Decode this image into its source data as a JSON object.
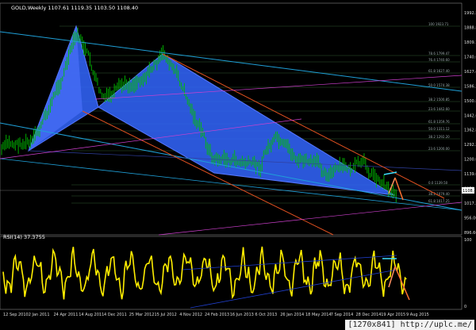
{
  "chart_data": [
    {
      "type": "candlestick",
      "symbol_header": "GOLD,Weekly  1107.61 1119.35 1103.50 1108.40",
      "y_ticks": [
        "1992.50",
        "1888.80",
        "1809.70",
        "1740.60",
        "1627.40",
        "1586.20",
        "1500.85",
        "1442.60",
        "1362.80",
        "1292.20",
        "1200.00",
        "1139.60",
        "1079.40",
        "1017.25",
        "956.00",
        "896.60"
      ],
      "price_marker": "1108.40",
      "x_ticks": [
        "12 Sep 2010",
        "2 Jan 2011",
        "24 Apr 2011",
        "14 Aug 2011",
        "4 Dec 2011",
        "25 Mar 2012",
        "15 Jul 2012",
        "4 Nov 2012",
        "24 Feb 2013",
        "16 Jun 2013",
        "6 Oct 2013",
        "26 Jan 2014",
        "18 May 2014",
        "7 Sep 2014",
        "28 Dec 2014",
        "19 Apr 2015",
        "9 Aug 2015"
      ],
      "fib_labels": [
        "100 1923.71",
        "78.6 1799.47",
        "76.4 1740.60",
        "61.8 1627.40",
        "50.0 1574.38",
        "38.2 1500.85",
        "23.6 1442.60",
        "61.8 1359.76",
        "50.0 1311.12",
        "38.2 1292.20",
        "23.6 1200.00",
        "0.0 1139.50",
        "38.2 1079.40",
        "61.8 1017.25"
      ],
      "patterns": [
        {
          "name": "first-harmonic-triangle",
          "color": "#3366ff"
        },
        {
          "name": "second-harmonic-triangle",
          "color": "#3366ff"
        }
      ],
      "colors": {
        "bullish": "#00c000",
        "bearish": "#00c000",
        "channel": "#1fa0d8",
        "resistance": "#e05020",
        "support": "#e05020",
        "magenta": "#d040d0",
        "arrow_up": "#ff9060",
        "arrow_down": "#ff7030",
        "arrow_cyan": "#40e0ff"
      }
    },
    {
      "type": "line",
      "indicator_label": "RSI(14) 37.3755",
      "y_ticks": [
        "100",
        "0"
      ],
      "line_color": "#ffee00"
    }
  ],
  "watermark": "[1270x841] http://uplc.me/"
}
